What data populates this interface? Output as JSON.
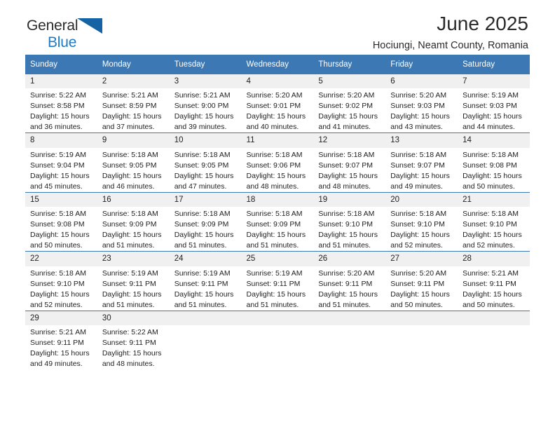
{
  "brand": {
    "line1": "General",
    "line2": "Blue",
    "triangle_icon": "blue-triangle-icon",
    "line1_color": "#2b2b2b",
    "line2_color": "#1e7ac4"
  },
  "header": {
    "title": "June 2025",
    "subtitle": "Hociungi, Neamt County, Romania"
  },
  "colors": {
    "header_blue": "#3c78b4",
    "daynum_bg": "#f0f0f0",
    "text": "#222222"
  },
  "calendar": {
    "weekday_headers": [
      "Sunday",
      "Monday",
      "Tuesday",
      "Wednesday",
      "Thursday",
      "Friday",
      "Saturday"
    ],
    "weeks": [
      [
        {
          "day": "1",
          "sunrise": "Sunrise: 5:22 AM",
          "sunset": "Sunset: 8:58 PM",
          "daylight1": "Daylight: 15 hours",
          "daylight2": "and 36 minutes."
        },
        {
          "day": "2",
          "sunrise": "Sunrise: 5:21 AM",
          "sunset": "Sunset: 8:59 PM",
          "daylight1": "Daylight: 15 hours",
          "daylight2": "and 37 minutes."
        },
        {
          "day": "3",
          "sunrise": "Sunrise: 5:21 AM",
          "sunset": "Sunset: 9:00 PM",
          "daylight1": "Daylight: 15 hours",
          "daylight2": "and 39 minutes."
        },
        {
          "day": "4",
          "sunrise": "Sunrise: 5:20 AM",
          "sunset": "Sunset: 9:01 PM",
          "daylight1": "Daylight: 15 hours",
          "daylight2": "and 40 minutes."
        },
        {
          "day": "5",
          "sunrise": "Sunrise: 5:20 AM",
          "sunset": "Sunset: 9:02 PM",
          "daylight1": "Daylight: 15 hours",
          "daylight2": "and 41 minutes."
        },
        {
          "day": "6",
          "sunrise": "Sunrise: 5:20 AM",
          "sunset": "Sunset: 9:03 PM",
          "daylight1": "Daylight: 15 hours",
          "daylight2": "and 43 minutes."
        },
        {
          "day": "7",
          "sunrise": "Sunrise: 5:19 AM",
          "sunset": "Sunset: 9:03 PM",
          "daylight1": "Daylight: 15 hours",
          "daylight2": "and 44 minutes."
        }
      ],
      [
        {
          "day": "8",
          "sunrise": "Sunrise: 5:19 AM",
          "sunset": "Sunset: 9:04 PM",
          "daylight1": "Daylight: 15 hours",
          "daylight2": "and 45 minutes."
        },
        {
          "day": "9",
          "sunrise": "Sunrise: 5:18 AM",
          "sunset": "Sunset: 9:05 PM",
          "daylight1": "Daylight: 15 hours",
          "daylight2": "and 46 minutes."
        },
        {
          "day": "10",
          "sunrise": "Sunrise: 5:18 AM",
          "sunset": "Sunset: 9:05 PM",
          "daylight1": "Daylight: 15 hours",
          "daylight2": "and 47 minutes."
        },
        {
          "day": "11",
          "sunrise": "Sunrise: 5:18 AM",
          "sunset": "Sunset: 9:06 PM",
          "daylight1": "Daylight: 15 hours",
          "daylight2": "and 48 minutes."
        },
        {
          "day": "12",
          "sunrise": "Sunrise: 5:18 AM",
          "sunset": "Sunset: 9:07 PM",
          "daylight1": "Daylight: 15 hours",
          "daylight2": "and 48 minutes."
        },
        {
          "day": "13",
          "sunrise": "Sunrise: 5:18 AM",
          "sunset": "Sunset: 9:07 PM",
          "daylight1": "Daylight: 15 hours",
          "daylight2": "and 49 minutes."
        },
        {
          "day": "14",
          "sunrise": "Sunrise: 5:18 AM",
          "sunset": "Sunset: 9:08 PM",
          "daylight1": "Daylight: 15 hours",
          "daylight2": "and 50 minutes."
        }
      ],
      [
        {
          "day": "15",
          "sunrise": "Sunrise: 5:18 AM",
          "sunset": "Sunset: 9:08 PM",
          "daylight1": "Daylight: 15 hours",
          "daylight2": "and 50 minutes."
        },
        {
          "day": "16",
          "sunrise": "Sunrise: 5:18 AM",
          "sunset": "Sunset: 9:09 PM",
          "daylight1": "Daylight: 15 hours",
          "daylight2": "and 51 minutes."
        },
        {
          "day": "17",
          "sunrise": "Sunrise: 5:18 AM",
          "sunset": "Sunset: 9:09 PM",
          "daylight1": "Daylight: 15 hours",
          "daylight2": "and 51 minutes."
        },
        {
          "day": "18",
          "sunrise": "Sunrise: 5:18 AM",
          "sunset": "Sunset: 9:09 PM",
          "daylight1": "Daylight: 15 hours",
          "daylight2": "and 51 minutes."
        },
        {
          "day": "19",
          "sunrise": "Sunrise: 5:18 AM",
          "sunset": "Sunset: 9:10 PM",
          "daylight1": "Daylight: 15 hours",
          "daylight2": "and 51 minutes."
        },
        {
          "day": "20",
          "sunrise": "Sunrise: 5:18 AM",
          "sunset": "Sunset: 9:10 PM",
          "daylight1": "Daylight: 15 hours",
          "daylight2": "and 52 minutes."
        },
        {
          "day": "21",
          "sunrise": "Sunrise: 5:18 AM",
          "sunset": "Sunset: 9:10 PM",
          "daylight1": "Daylight: 15 hours",
          "daylight2": "and 52 minutes."
        }
      ],
      [
        {
          "day": "22",
          "sunrise": "Sunrise: 5:18 AM",
          "sunset": "Sunset: 9:10 PM",
          "daylight1": "Daylight: 15 hours",
          "daylight2": "and 52 minutes."
        },
        {
          "day": "23",
          "sunrise": "Sunrise: 5:19 AM",
          "sunset": "Sunset: 9:11 PM",
          "daylight1": "Daylight: 15 hours",
          "daylight2": "and 51 minutes."
        },
        {
          "day": "24",
          "sunrise": "Sunrise: 5:19 AM",
          "sunset": "Sunset: 9:11 PM",
          "daylight1": "Daylight: 15 hours",
          "daylight2": "and 51 minutes."
        },
        {
          "day": "25",
          "sunrise": "Sunrise: 5:19 AM",
          "sunset": "Sunset: 9:11 PM",
          "daylight1": "Daylight: 15 hours",
          "daylight2": "and 51 minutes."
        },
        {
          "day": "26",
          "sunrise": "Sunrise: 5:20 AM",
          "sunset": "Sunset: 9:11 PM",
          "daylight1": "Daylight: 15 hours",
          "daylight2": "and 51 minutes."
        },
        {
          "day": "27",
          "sunrise": "Sunrise: 5:20 AM",
          "sunset": "Sunset: 9:11 PM",
          "daylight1": "Daylight: 15 hours",
          "daylight2": "and 50 minutes."
        },
        {
          "day": "28",
          "sunrise": "Sunrise: 5:21 AM",
          "sunset": "Sunset: 9:11 PM",
          "daylight1": "Daylight: 15 hours",
          "daylight2": "and 50 minutes."
        }
      ],
      [
        {
          "day": "29",
          "sunrise": "Sunrise: 5:21 AM",
          "sunset": "Sunset: 9:11 PM",
          "daylight1": "Daylight: 15 hours",
          "daylight2": "and 49 minutes."
        },
        {
          "day": "30",
          "sunrise": "Sunrise: 5:22 AM",
          "sunset": "Sunset: 9:11 PM",
          "daylight1": "Daylight: 15 hours",
          "daylight2": "and 48 minutes."
        },
        {
          "day": "",
          "sunrise": "",
          "sunset": "",
          "daylight1": "",
          "daylight2": ""
        },
        {
          "day": "",
          "sunrise": "",
          "sunset": "",
          "daylight1": "",
          "daylight2": ""
        },
        {
          "day": "",
          "sunrise": "",
          "sunset": "",
          "daylight1": "",
          "daylight2": ""
        },
        {
          "day": "",
          "sunrise": "",
          "sunset": "",
          "daylight1": "",
          "daylight2": ""
        },
        {
          "day": "",
          "sunrise": "",
          "sunset": "",
          "daylight1": "",
          "daylight2": ""
        }
      ]
    ]
  }
}
